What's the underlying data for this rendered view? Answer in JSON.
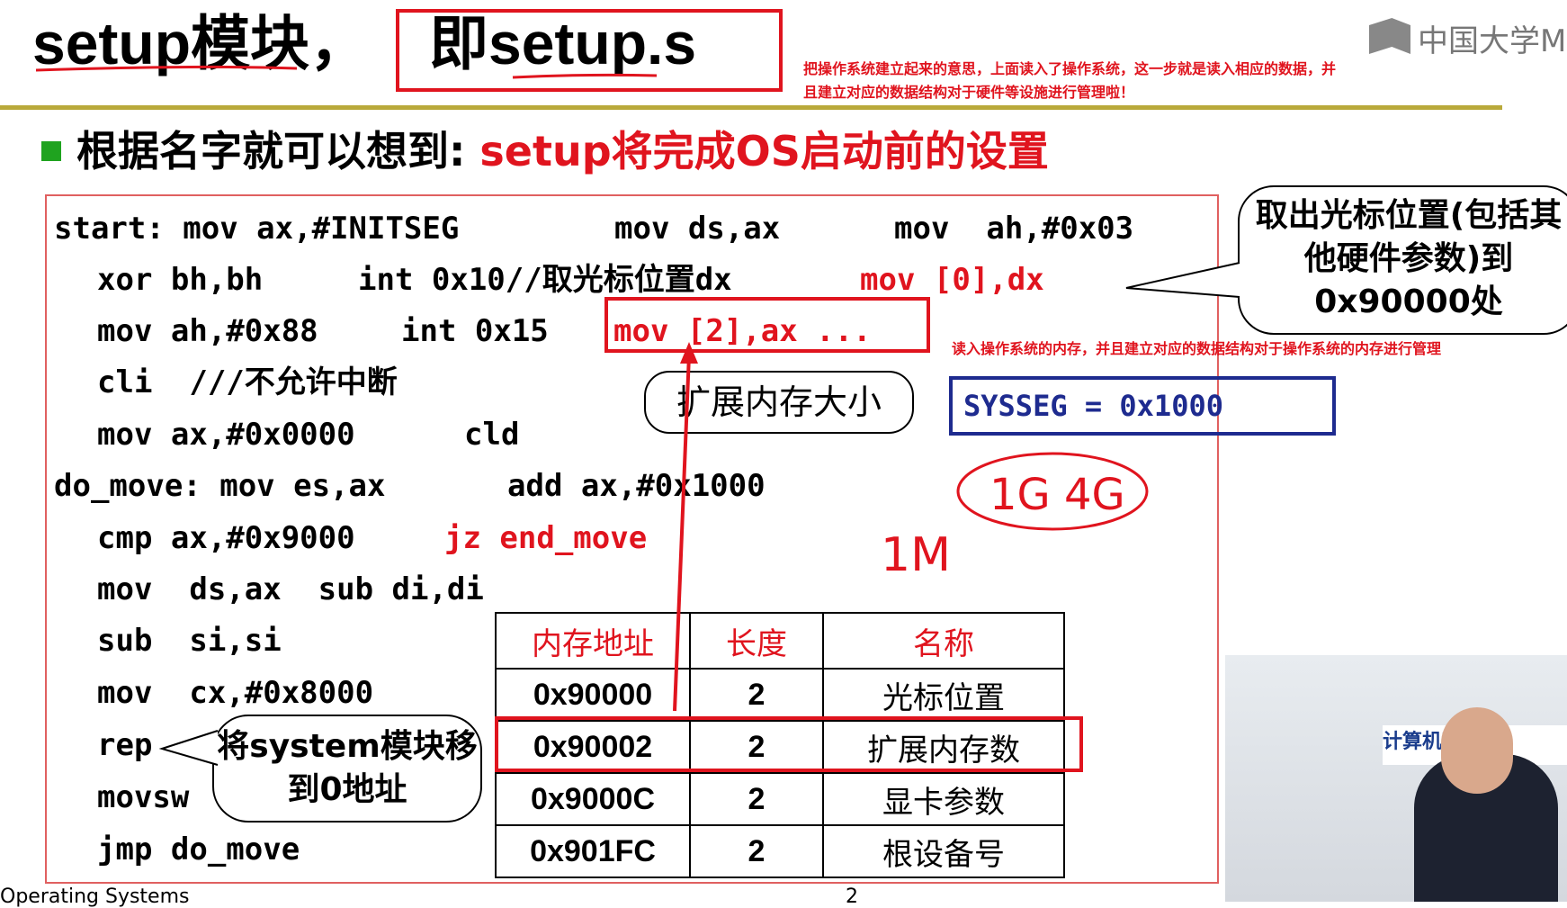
{
  "title": {
    "main": "setup模块，",
    "boxed": "即setup.s"
  },
  "notes": {
    "top": "把操作系统建立起来的意思，上面读入了操作系统，这一步就是读入相应的数据，并且建立对应的数据结构对于硬件等设施进行管理啦！",
    "mid": "读入操作系统的内存，并且建立对应的数据结构对于操作系统的内存进行管理"
  },
  "logo": {
    "text": "中国大学MO"
  },
  "headline": {
    "prefix": "根据名字就可以想到: ",
    "highlight": "setup将完成OS启动前的设置"
  },
  "code": {
    "l1a": "start: mov ax,#INITSEG",
    "l1b": "mov ds,ax",
    "l1c": "mov  ah,#0x03",
    "l2a": "xor bh,bh",
    "l2b": "int 0x10//取光标位置dx",
    "l2c": "mov [0],dx",
    "l3a": "mov ah,#0x88",
    "l3b": "int 0x15",
    "l3c": "mov [2],ax ...",
    "l4": "cli  ///不允许中断",
    "l5a": "mov ax,#0x0000",
    "l5b": "cld",
    "l6a": "do_move: mov es,ax",
    "l6b": "add ax,#0x1000",
    "l7a": "cmp ax,#0x9000",
    "l7b": "jz end_move",
    "l8": "mov  ds,ax  sub di,di",
    "l9": "sub  si,si",
    "l10": "mov  cx,#0x8000",
    "l11": "rep",
    "l12": "movsw",
    "l13": "jmp do_move"
  },
  "bubbles": {
    "cursor": "取出光标位置(包括其他硬件参数)到0x90000处",
    "extmem": "扩展内存大小",
    "system": "将system模块移到0地址"
  },
  "sysseg": "SYSSEG = 0x1000",
  "handwriting": {
    "a": "1G 4G",
    "b": "1M"
  },
  "table": {
    "headers": [
      "内存地址",
      "长度",
      "名称"
    ],
    "rows": [
      [
        "0x90000",
        "2",
        "光标位置"
      ],
      [
        "0x90002",
        "2",
        "扩展内存数"
      ],
      [
        "0x9000C",
        "2",
        "显卡参数"
      ],
      [
        "0x901FC",
        "2",
        "根设备号"
      ]
    ]
  },
  "video": {
    "sign": "计算机科学与"
  },
  "footer": {
    "page": "2",
    "left": "Operating Systems"
  }
}
